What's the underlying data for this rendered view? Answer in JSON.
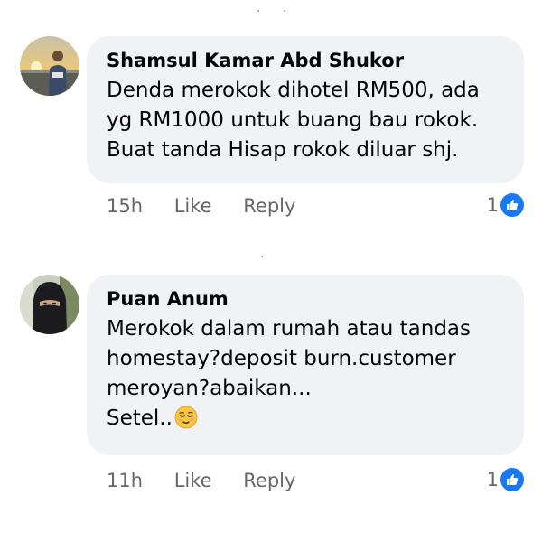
{
  "comments": [
    {
      "author": "Shamsul Kamar Abd Shukor",
      "lines": [
        "Denda merokok dihotel RM500, ada",
        "yg RM1000 untuk buang bau rokok.",
        "Buat tanda Hisap rokok diluar shj."
      ],
      "time": "15h",
      "like_label": "Like",
      "reply_label": "Reply",
      "reaction_count": "1",
      "avatar_icon": "avatar-man-sunset-photo",
      "reaction_icon": "thumbs-up-icon"
    },
    {
      "author": "Puan Anum",
      "lines": [
        "Merokok dalam rumah atau tandas",
        "homestay?deposit burn.customer",
        "meroyan?abaikan...",
        "Setel.."
      ],
      "emoji_icon": "relieved-face-emoji",
      "time": "11h",
      "like_label": "Like",
      "reply_label": "Reply",
      "reaction_count": "1",
      "avatar_icon": "avatar-woman-niqab-photo",
      "reaction_icon": "thumbs-up-icon"
    }
  ],
  "colors": {
    "bubble_bg": "#f0f2f5",
    "secondary_text": "#65676b",
    "like_blue": "#1877f2",
    "primary_text": "#050505"
  }
}
